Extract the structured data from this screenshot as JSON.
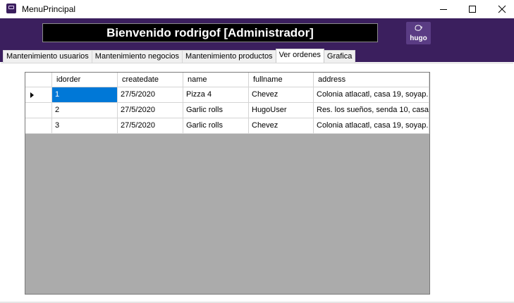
{
  "window": {
    "title": "MenuPrincipal",
    "controls": [
      "minimize-icon",
      "maximize-icon",
      "close-icon"
    ]
  },
  "header": {
    "welcome": "Bienvenido rodrigof [Administrador]",
    "logo_text": "hugo",
    "background_color": "#3b1f5e"
  },
  "tabs": [
    {
      "label": "Mantenimiento usuarios"
    },
    {
      "label": "Mantenimiento negocios"
    },
    {
      "label": "Mantenimiento productos"
    },
    {
      "label": "Ver ordenes",
      "active": true
    },
    {
      "label": "Grafica"
    }
  ],
  "grid": {
    "columns": [
      "idorder",
      "createdate",
      "name",
      "fullname",
      "address"
    ],
    "rows": [
      [
        "1",
        "27/5/2020",
        "Pizza 4",
        "Chevez",
        "Colonia atlacatl, casa 19, soyap..."
      ],
      [
        "2",
        "27/5/2020",
        "Garlic rolls",
        "HugoUser",
        "Res. los sueños, senda 10, casa..."
      ],
      [
        "3",
        "27/5/2020",
        "Garlic rolls",
        "Chevez",
        "Colonia atlacatl, casa 19, soyap..."
      ]
    ],
    "current_row": 1,
    "selected_cell_color": "#0078d7"
  }
}
